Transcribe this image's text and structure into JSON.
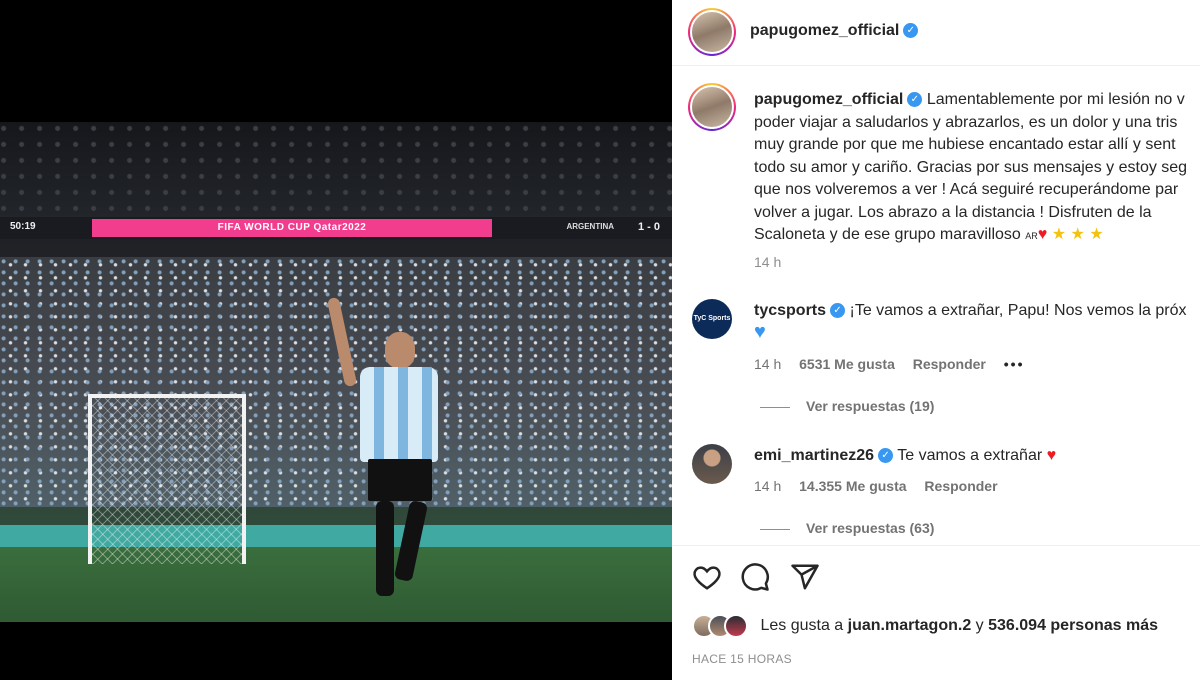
{
  "media": {
    "broadcast_clock": "50:19",
    "broadcast_banner": "FIFA WORLD CUP Qatar2022",
    "broadcast_team": "ARGENTINA",
    "broadcast_score": "1 - 0"
  },
  "post": {
    "author": "papugomez_official",
    "caption": {
      "lines": [
        "Lamentablemente por mi lesión no v",
        "poder viajar a saludarlos y abrazarlos, es un dolor y una tris",
        "muy grande por que me hubiese encantado estar allí y sent",
        "todo su amor y cariño. Gracias por sus mensajes y estoy seg",
        "que nos volveremos a ver ! Acá seguiré recuperándome par",
        "volver a jugar. Los abrazo a la distancia ! Disfruten de la",
        "Scaloneta y de ese grupo maravilloso"
      ],
      "flag_text": "AR",
      "heart": "♥",
      "stars": "★ ★ ★"
    },
    "time": "14 h"
  },
  "comments": [
    {
      "author": "tycsports",
      "avatar_label": "TyC Sports",
      "text": "¡Te vamos a extrañar, Papu! Nos vemos la próx",
      "emoji": "♥",
      "time": "14 h",
      "likes": "6531 Me gusta",
      "reply": "Responder",
      "more": "•••",
      "view_replies": "Ver respuestas (19)"
    },
    {
      "author": "emi_martinez26",
      "text": "Te vamos a extrañar",
      "emoji": "♥",
      "time": "14 h",
      "likes": "14.355 Me gusta",
      "reply": "Responder",
      "view_replies": "Ver respuestas (63)"
    }
  ],
  "actions": {
    "icons": [
      "heart-icon",
      "comment-icon",
      "share-icon"
    ],
    "likes_prefix": "Les gusta a",
    "likes_user": "juan.martagon.2",
    "likes_connector": "y",
    "likes_count": "536.094 personas más",
    "posted_ago": "HACE 15 HORAS"
  },
  "colors": {
    "verified": "#3897f0",
    "heart_red": "#ed1c24",
    "star": "#f5c30f",
    "text": "#262626",
    "muted": "#8e8e8e"
  }
}
